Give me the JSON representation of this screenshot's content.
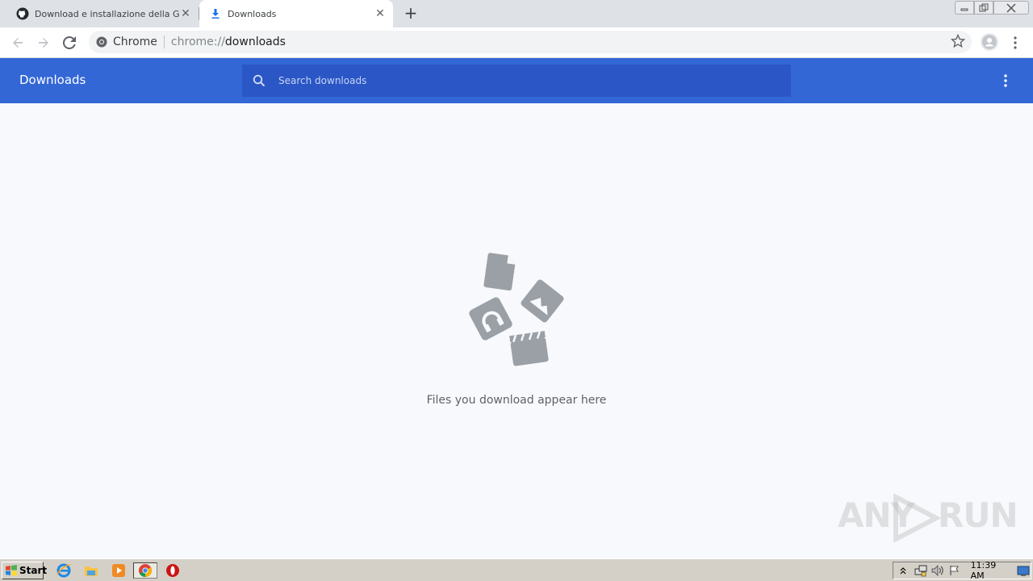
{
  "tabs": [
    {
      "title": "Download e installazione della Guida",
      "icon": "github-icon",
      "active": false
    },
    {
      "title": "Downloads",
      "icon": "download-icon",
      "active": true
    }
  ],
  "omnibox": {
    "chip": "Chrome",
    "scheme": "chrome://",
    "host": "downloads"
  },
  "downloads": {
    "title": "Downloads",
    "search_placeholder": "Search downloads",
    "empty_message": "Files you download appear here"
  },
  "watermark": {
    "left": "ANY",
    "right": "RUN"
  },
  "taskbar": {
    "start_label": "Start",
    "clock": "11:39 AM",
    "pinned": [
      "ie-icon",
      "explorer-icon",
      "media-player-icon",
      "chrome-icon",
      "opera-icon"
    ]
  },
  "colors": {
    "header_bg": "#3367d6",
    "search_bg": "#2a56c6",
    "page_bg": "#f7f9fc",
    "illustration": "#9aa0a6"
  }
}
